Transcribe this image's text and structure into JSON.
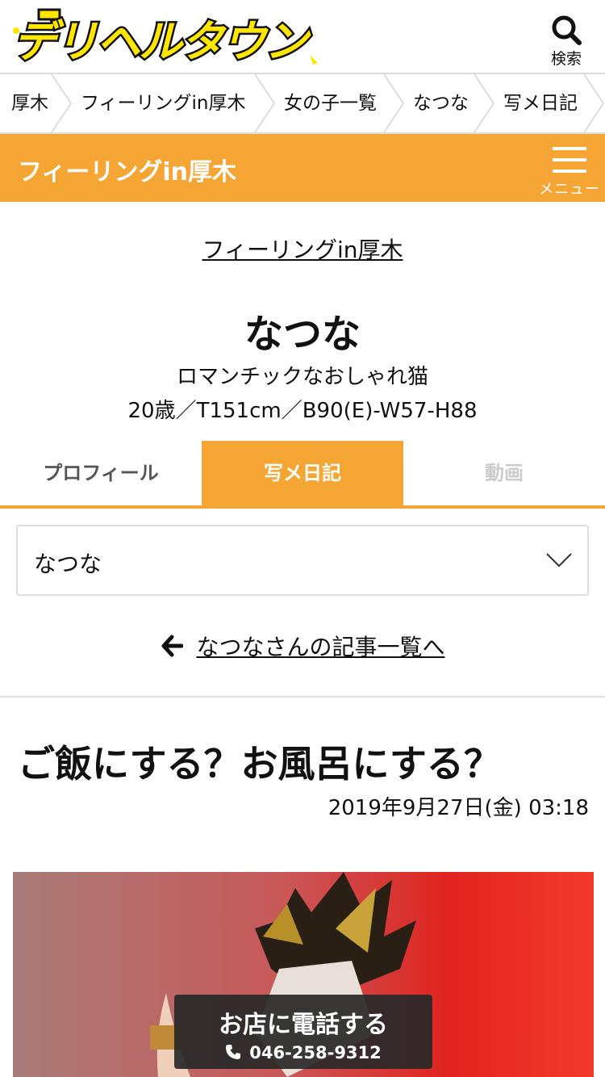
{
  "header": {
    "logo_text": "デリヘルタウン",
    "search_label": "検索"
  },
  "breadcrumb": [
    "厚木",
    "フィーリングin厚木",
    "女の子一覧",
    "なつな",
    "写メ日記"
  ],
  "shop_bar": {
    "title": "フィーリングin厚木",
    "menu_label": "メニュー"
  },
  "profile": {
    "shop_link": "フィーリングin厚木",
    "name": "なつな",
    "catch_copy": "ロマンチックなおしゃれ猫",
    "spec": "20歳／T151cm／B90(E)-W57-H88"
  },
  "tabs": [
    "プロフィール",
    "写メ日記",
    "動画"
  ],
  "select": {
    "value": "なつな"
  },
  "back_link": "なつなさんの記事一覧へ",
  "article": {
    "title": "ご飯にする？お風呂にする？",
    "date": "2019年9月27日(金) 03:18"
  },
  "call_button": {
    "label": "お店に電話する",
    "tel": "046-258-9312"
  },
  "colors": {
    "accent": "#f5a534",
    "logo_yellow": "#ffe600",
    "call_bg": "#282828"
  }
}
